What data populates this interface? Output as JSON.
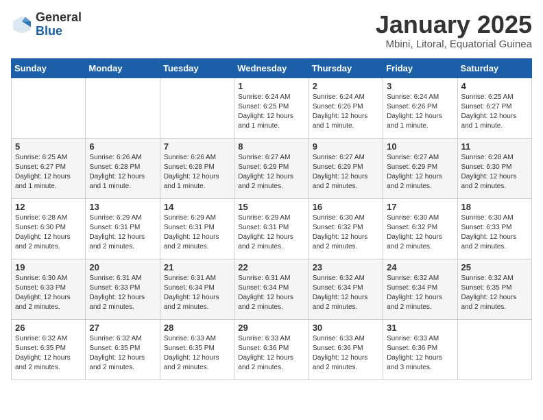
{
  "logo": {
    "general": "General",
    "blue": "Blue"
  },
  "title": "January 2025",
  "subtitle": "Mbini, Litoral, Equatorial Guinea",
  "days_of_week": [
    "Sunday",
    "Monday",
    "Tuesday",
    "Wednesday",
    "Thursday",
    "Friday",
    "Saturday"
  ],
  "weeks": [
    [
      {
        "day": "",
        "sunrise": "",
        "sunset": "",
        "daylight": ""
      },
      {
        "day": "",
        "sunrise": "",
        "sunset": "",
        "daylight": ""
      },
      {
        "day": "",
        "sunrise": "",
        "sunset": "",
        "daylight": ""
      },
      {
        "day": "1",
        "sunrise": "Sunrise: 6:24 AM",
        "sunset": "Sunset: 6:25 PM",
        "daylight": "Daylight: 12 hours and 1 minute."
      },
      {
        "day": "2",
        "sunrise": "Sunrise: 6:24 AM",
        "sunset": "Sunset: 6:26 PM",
        "daylight": "Daylight: 12 hours and 1 minute."
      },
      {
        "day": "3",
        "sunrise": "Sunrise: 6:24 AM",
        "sunset": "Sunset: 6:26 PM",
        "daylight": "Daylight: 12 hours and 1 minute."
      },
      {
        "day": "4",
        "sunrise": "Sunrise: 6:25 AM",
        "sunset": "Sunset: 6:27 PM",
        "daylight": "Daylight: 12 hours and 1 minute."
      }
    ],
    [
      {
        "day": "5",
        "sunrise": "Sunrise: 6:25 AM",
        "sunset": "Sunset: 6:27 PM",
        "daylight": "Daylight: 12 hours and 1 minute."
      },
      {
        "day": "6",
        "sunrise": "Sunrise: 6:26 AM",
        "sunset": "Sunset: 6:28 PM",
        "daylight": "Daylight: 12 hours and 1 minute."
      },
      {
        "day": "7",
        "sunrise": "Sunrise: 6:26 AM",
        "sunset": "Sunset: 6:28 PM",
        "daylight": "Daylight: 12 hours and 1 minute."
      },
      {
        "day": "8",
        "sunrise": "Sunrise: 6:27 AM",
        "sunset": "Sunset: 6:29 PM",
        "daylight": "Daylight: 12 hours and 2 minutes."
      },
      {
        "day": "9",
        "sunrise": "Sunrise: 6:27 AM",
        "sunset": "Sunset: 6:29 PM",
        "daylight": "Daylight: 12 hours and 2 minutes."
      },
      {
        "day": "10",
        "sunrise": "Sunrise: 6:27 AM",
        "sunset": "Sunset: 6:29 PM",
        "daylight": "Daylight: 12 hours and 2 minutes."
      },
      {
        "day": "11",
        "sunrise": "Sunrise: 6:28 AM",
        "sunset": "Sunset: 6:30 PM",
        "daylight": "Daylight: 12 hours and 2 minutes."
      }
    ],
    [
      {
        "day": "12",
        "sunrise": "Sunrise: 6:28 AM",
        "sunset": "Sunset: 6:30 PM",
        "daylight": "Daylight: 12 hours and 2 minutes."
      },
      {
        "day": "13",
        "sunrise": "Sunrise: 6:29 AM",
        "sunset": "Sunset: 6:31 PM",
        "daylight": "Daylight: 12 hours and 2 minutes."
      },
      {
        "day": "14",
        "sunrise": "Sunrise: 6:29 AM",
        "sunset": "Sunset: 6:31 PM",
        "daylight": "Daylight: 12 hours and 2 minutes."
      },
      {
        "day": "15",
        "sunrise": "Sunrise: 6:29 AM",
        "sunset": "Sunset: 6:31 PM",
        "daylight": "Daylight: 12 hours and 2 minutes."
      },
      {
        "day": "16",
        "sunrise": "Sunrise: 6:30 AM",
        "sunset": "Sunset: 6:32 PM",
        "daylight": "Daylight: 12 hours and 2 minutes."
      },
      {
        "day": "17",
        "sunrise": "Sunrise: 6:30 AM",
        "sunset": "Sunset: 6:32 PM",
        "daylight": "Daylight: 12 hours and 2 minutes."
      },
      {
        "day": "18",
        "sunrise": "Sunrise: 6:30 AM",
        "sunset": "Sunset: 6:33 PM",
        "daylight": "Daylight: 12 hours and 2 minutes."
      }
    ],
    [
      {
        "day": "19",
        "sunrise": "Sunrise: 6:30 AM",
        "sunset": "Sunset: 6:33 PM",
        "daylight": "Daylight: 12 hours and 2 minutes."
      },
      {
        "day": "20",
        "sunrise": "Sunrise: 6:31 AM",
        "sunset": "Sunset: 6:33 PM",
        "daylight": "Daylight: 12 hours and 2 minutes."
      },
      {
        "day": "21",
        "sunrise": "Sunrise: 6:31 AM",
        "sunset": "Sunset: 6:34 PM",
        "daylight": "Daylight: 12 hours and 2 minutes."
      },
      {
        "day": "22",
        "sunrise": "Sunrise: 6:31 AM",
        "sunset": "Sunset: 6:34 PM",
        "daylight": "Daylight: 12 hours and 2 minutes."
      },
      {
        "day": "23",
        "sunrise": "Sunrise: 6:32 AM",
        "sunset": "Sunset: 6:34 PM",
        "daylight": "Daylight: 12 hours and 2 minutes."
      },
      {
        "day": "24",
        "sunrise": "Sunrise: 6:32 AM",
        "sunset": "Sunset: 6:34 PM",
        "daylight": "Daylight: 12 hours and 2 minutes."
      },
      {
        "day": "25",
        "sunrise": "Sunrise: 6:32 AM",
        "sunset": "Sunset: 6:35 PM",
        "daylight": "Daylight: 12 hours and 2 minutes."
      }
    ],
    [
      {
        "day": "26",
        "sunrise": "Sunrise: 6:32 AM",
        "sunset": "Sunset: 6:35 PM",
        "daylight": "Daylight: 12 hours and 2 minutes."
      },
      {
        "day": "27",
        "sunrise": "Sunrise: 6:32 AM",
        "sunset": "Sunset: 6:35 PM",
        "daylight": "Daylight: 12 hours and 2 minutes."
      },
      {
        "day": "28",
        "sunrise": "Sunrise: 6:33 AM",
        "sunset": "Sunset: 6:35 PM",
        "daylight": "Daylight: 12 hours and 2 minutes."
      },
      {
        "day": "29",
        "sunrise": "Sunrise: 6:33 AM",
        "sunset": "Sunset: 6:36 PM",
        "daylight": "Daylight: 12 hours and 2 minutes."
      },
      {
        "day": "30",
        "sunrise": "Sunrise: 6:33 AM",
        "sunset": "Sunset: 6:36 PM",
        "daylight": "Daylight: 12 hours and 2 minutes."
      },
      {
        "day": "31",
        "sunrise": "Sunrise: 6:33 AM",
        "sunset": "Sunset: 6:36 PM",
        "daylight": "Daylight: 12 hours and 3 minutes."
      },
      {
        "day": "",
        "sunrise": "",
        "sunset": "",
        "daylight": ""
      }
    ]
  ]
}
